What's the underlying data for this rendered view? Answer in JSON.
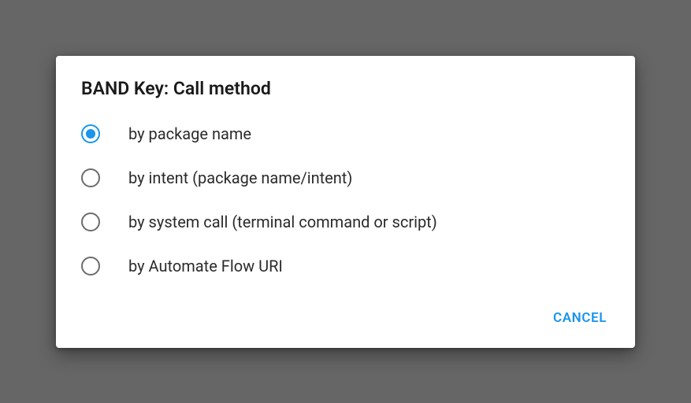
{
  "dialog": {
    "title": "BAND Key: Call method",
    "options": [
      {
        "label": "by package name",
        "selected": true
      },
      {
        "label": "by intent (package name/intent)",
        "selected": false
      },
      {
        "label": "by system call (terminal command or script)",
        "selected": false
      },
      {
        "label": "by Automate Flow URI",
        "selected": false
      }
    ],
    "cancel_label": "CANCEL"
  }
}
